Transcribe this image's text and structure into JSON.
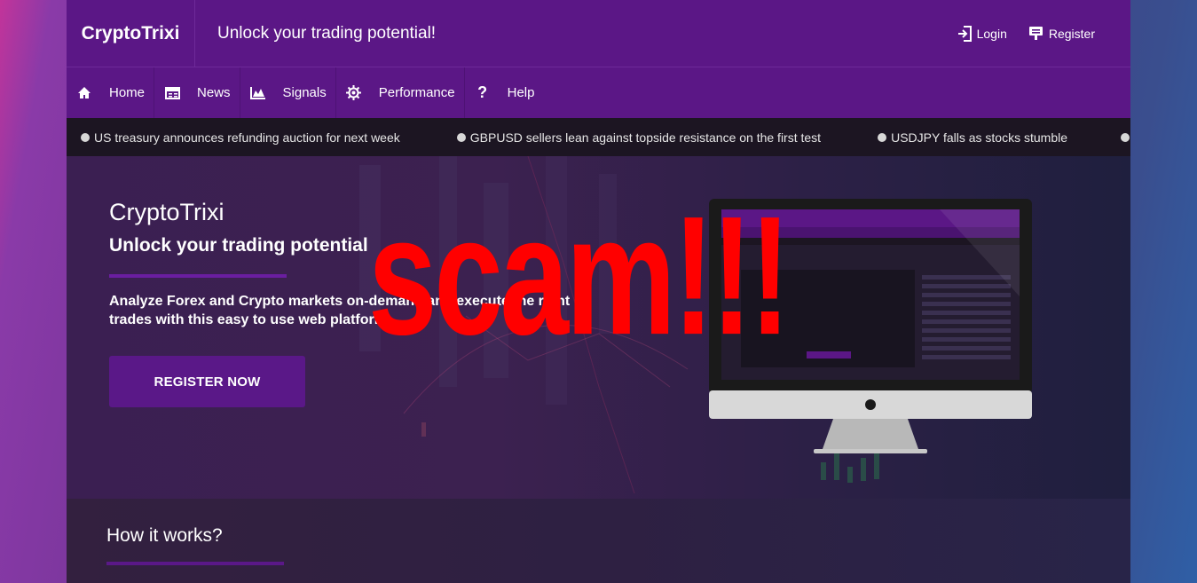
{
  "header": {
    "brand": "CryptoTrixi",
    "tagline": "Unlock your trading potential!",
    "login_label": "Login",
    "register_label": "Register"
  },
  "nav": {
    "items": [
      {
        "label": "Home",
        "icon": "home-icon"
      },
      {
        "label": "News",
        "icon": "news-icon"
      },
      {
        "label": "Signals",
        "icon": "chart-icon"
      },
      {
        "label": "Performance",
        "icon": "gear-icon"
      },
      {
        "label": "Help",
        "icon": "question-icon"
      }
    ]
  },
  "ticker": [
    "US treasury announces refunding auction for next week",
    "GBPUSD sellers lean against topside resistance on the first test",
    "USDJPY falls as stocks stumble"
  ],
  "hero": {
    "title": "CryptoTrixi",
    "subtitle": "Unlock your trading potential",
    "description": "Analyze Forex and Crypto markets on-demand and execute the right trades with this easy to use web platform.",
    "cta_label": "REGISTER NOW",
    "overlay_text": "scam!!!"
  },
  "how_it_works": {
    "title": "How it works?"
  },
  "colors": {
    "header_purple": "#5b1786",
    "cta_purple": "#5a1888",
    "overlay_red": "#ff0000",
    "ticker_bg": "#1c1522"
  }
}
